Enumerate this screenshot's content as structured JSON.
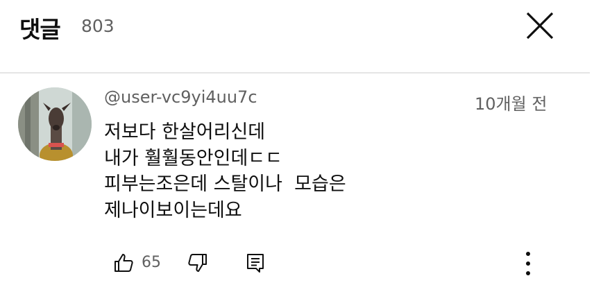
{
  "header": {
    "title": "댓글",
    "count": "803"
  },
  "comment": {
    "author": "@user-vc9yi4uu7c",
    "time": "10개월 전",
    "text": "저보다 한살어리신데\n내가 훨훨동안인데ㄷㄷ\n피부는조은데 스탈이나  모습은\n제나이보이는데요",
    "likes": "65"
  },
  "icons": {
    "close": "close-icon",
    "like": "thumbs-up-icon",
    "dislike": "thumbs-down-icon",
    "reply": "reply-comment-icon",
    "more": "more-vertical-icon"
  }
}
